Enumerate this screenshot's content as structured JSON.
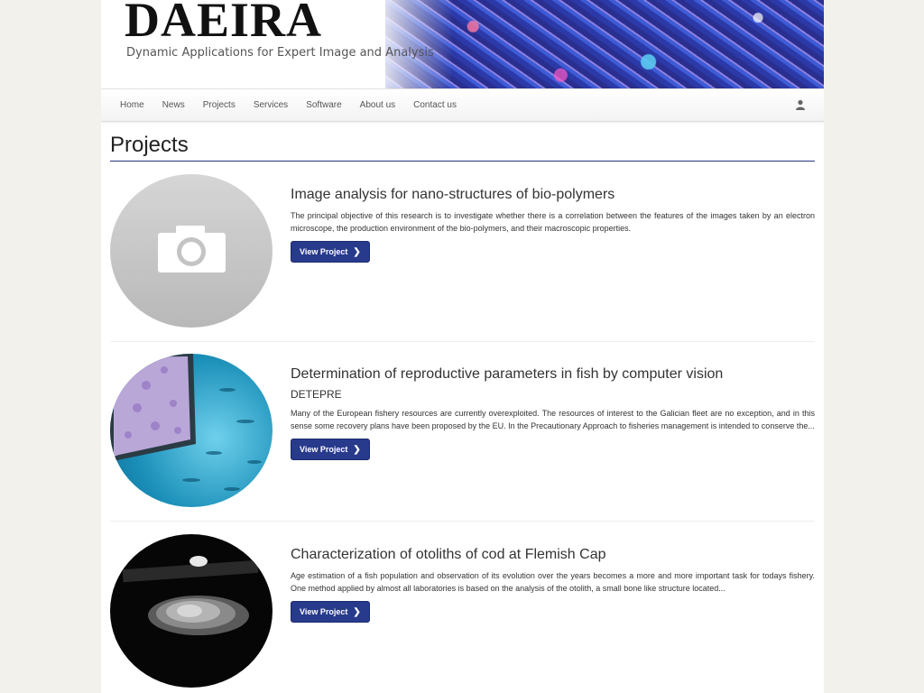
{
  "brand": {
    "logo": "DAEIRA",
    "tagline": "Dynamic Applications for Expert Image and Analysis"
  },
  "nav": {
    "items": [
      "Home",
      "News",
      "Projects",
      "Services",
      "Software",
      "About us",
      "Contact us"
    ]
  },
  "page": {
    "title": "Projects"
  },
  "projects": [
    {
      "title": "Image analysis for nano-structures of bio-polymers",
      "subtitle": "",
      "description": "The principal objective of this research is to investigate whether there is a correlation between the features of the images taken by an electron microscope, the production environment of the bio-polymers, and their macroscopic properties.",
      "button": "View Project",
      "image": "camera-placeholder-icon"
    },
    {
      "title": "Determination of reproductive parameters in fish by computer vision",
      "subtitle": "DETEPRE",
      "description": "Many of the European fishery resources are currently overexploited. The resources of interest to the Galician fleet are no exception, and in this sense some recovery plans have been proposed by the EU. In the Precautionary Approach to fisheries management is intended to conserve the...",
      "button": "View Project",
      "image": "aquarium-monitor-photo"
    },
    {
      "title": "Characterization of otoliths of cod at Flemish Cap",
      "subtitle": "",
      "description": "Age estimation of a fish population and observation of its evolution over the years becomes a more and more important task for todays fishery. One method applied by almost all laboratories is based on the analysis of the otolith, a small bone like structure located...",
      "button": "View Project",
      "image": "otolith-photo"
    }
  ],
  "colors": {
    "primary_button": "#283a8c",
    "title_rule": "#2a3582",
    "background": "#f3f1ec"
  }
}
